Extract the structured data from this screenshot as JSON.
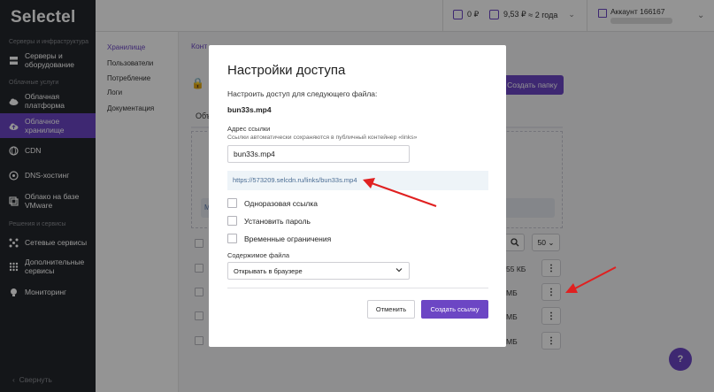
{
  "app": {
    "logo": "Selectel",
    "sidebar": {
      "section_servers": "Серверы и инфраструктура",
      "section_cloud": "Облачные услуги",
      "section_solutions": "Решения и сервисы",
      "items": [
        {
          "label": "Серверы и оборудование",
          "icon": "server-icon"
        },
        {
          "label": "Облачная платформа",
          "icon": "cloud-icon"
        },
        {
          "label": "Облачное хранилище",
          "icon": "cloud-upload-icon",
          "active": true
        },
        {
          "label": "CDN",
          "icon": "globe-icon"
        },
        {
          "label": "DNS-хостинг",
          "icon": "dns-icon"
        },
        {
          "label": "Облако на базе VMware",
          "icon": "vmware-icon"
        },
        {
          "label": "Сетевые сервисы",
          "icon": "network-icon"
        },
        {
          "label": "Дополнительные сервисы",
          "icon": "grid-icon"
        },
        {
          "label": "Мониторинг",
          "icon": "bulb-icon"
        }
      ],
      "collapse_label": "Свернуть"
    },
    "topbar": {
      "balance_1": "0 ₽",
      "balance_2": "9,53 ₽",
      "balance_2_period": "≈ 2 года",
      "account": "Аккаунт 166167"
    },
    "subnav": {
      "items": [
        {
          "label": "Хранилище",
          "active": true
        },
        {
          "label": "Пользователи"
        },
        {
          "label": "Потребление"
        },
        {
          "label": "Логи"
        },
        {
          "label": "Документация"
        }
      ]
    },
    "main": {
      "breadcrumb": "Конт",
      "create_folder": "Создать папку",
      "tab_objects": "Объ",
      "drop_hint": "М",
      "per_page": "50",
      "rows": [
        {
          "size": "55 КБ"
        },
        {
          "size": "МБ"
        },
        {
          "size": "МБ"
        },
        {
          "size": "МБ"
        }
      ],
      "help": "?"
    }
  },
  "modal": {
    "title": "Настройки доступа",
    "subtitle": "Настроить доступ для следующего файла:",
    "filename": "bun33s.mp4",
    "address_label": "Адрес ссылки",
    "address_hint": "Ссылки автоматически сохраняются в публичный контейнер «links»",
    "address_value": "bun33s.mp4",
    "link_url": "https://573209.selcdn.ru/links/bun33s.mp4",
    "options": [
      {
        "label": "Одноразовая ссылка",
        "checked": false
      },
      {
        "label": "Установить пароль",
        "checked": false
      },
      {
        "label": "Временные ограничения",
        "checked": false
      }
    ],
    "content_label": "Содержимое файла",
    "content_value": "Открывать в браузере",
    "cancel": "Отменить",
    "create": "Создать ссылку"
  },
  "colors": {
    "accent": "#6c46c4",
    "sidebar_bg": "#24262b",
    "arrow": "#e02020"
  }
}
